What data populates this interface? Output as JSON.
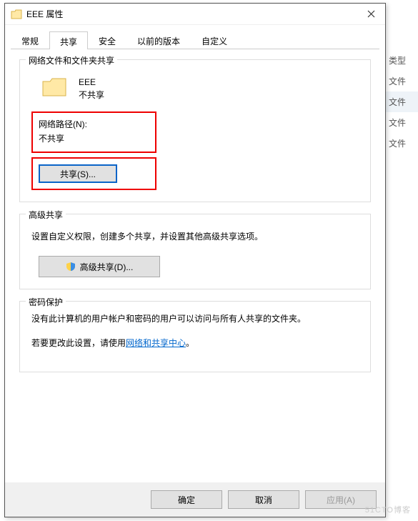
{
  "titlebar": {
    "title": "EEE 属性"
  },
  "tabs": {
    "general": "常规",
    "sharing": "共享",
    "security": "安全",
    "previous": "以前的版本",
    "custom": "自定义"
  },
  "network_share": {
    "group_label": "网络文件和文件夹共享",
    "folder_name": "EEE",
    "share_status": "不共享",
    "path_label": "网络路径(N):",
    "path_value": "不共享",
    "share_button": "共享(S)..."
  },
  "advanced_share": {
    "group_label": "高级共享",
    "description": "设置自定义权限，创建多个共享，并设置其他高级共享选项。",
    "button": "高级共享(D)..."
  },
  "password": {
    "group_label": "密码保护",
    "line1": "没有此计算机的用户帐户和密码的用户可以访问与所有人共享的文件夹。",
    "line2_prefix": "若要更改此设置，请使用",
    "line2_link": "网络和共享中心",
    "line2_suffix": "。"
  },
  "buttons": {
    "ok": "确定",
    "cancel": "取消",
    "apply": "应用(A)"
  },
  "backdrop": {
    "type": "类型",
    "f1": "文件",
    "f2": "文件",
    "f3": "文件",
    "f4": "文件"
  },
  "watermark": "51CTO博客"
}
